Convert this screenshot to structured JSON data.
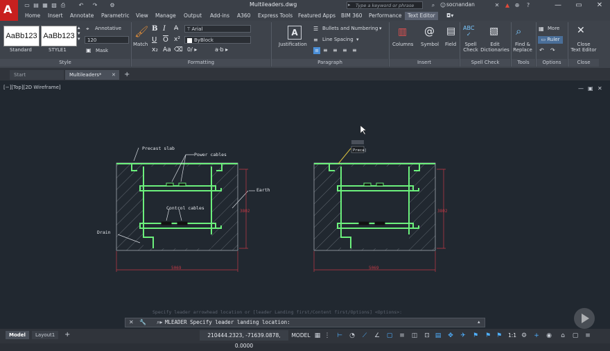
{
  "app": {
    "doc_title": "Multileaders.dwg",
    "search_placeholder": "Type a keyword or phrase",
    "user": "socnandan"
  },
  "ribbon_tabs": [
    "Home",
    "Insert",
    "Annotate",
    "Parametric",
    "View",
    "Manage",
    "Output",
    "Add-ins",
    "A360",
    "Express Tools",
    "Featured Apps",
    "BIM 360",
    "Performance",
    "Text Editor"
  ],
  "ribbon": {
    "style": {
      "style1": "AaBb123",
      "style1_name": "Standard",
      "style2": "AaBb123",
      "style2_name": "STYLE1",
      "annotative": "Annotative",
      "height": "120",
      "mask": "Mask",
      "title": "Style"
    },
    "formatting": {
      "match": "Match",
      "bold": "B",
      "italic": "I",
      "underline": "U",
      "overline": "O",
      "strike": "ʘ",
      "font": "Arial",
      "color": "ByBlock",
      "title": "Formatting"
    },
    "paragraph": {
      "justification": "Justification",
      "bullets": "Bullets and Numbering",
      "line_spacing": "Line Spacing",
      "title": "Paragraph"
    },
    "insert": {
      "columns": "Columns",
      "symbol": "Symbol",
      "field": "Field",
      "title": "Insert"
    },
    "spell": {
      "spell_check_l1": "Spell",
      "spell_check_l2": "Check",
      "edit_dict_l1": "Edit",
      "edit_dict_l2": "Dictionaries",
      "title": "Spell Check"
    },
    "tools": {
      "find_l1": "Find &",
      "find_l2": "Replace",
      "title": "Tools"
    },
    "options": {
      "more": "More",
      "ruler": "Ruler",
      "title": "Options"
    },
    "close": {
      "close_l1": "Close",
      "close_l2": "Text Editor",
      "title": "Close"
    }
  },
  "doc_tabs": {
    "start": "Start",
    "active": "Multileaders*"
  },
  "viewport": {
    "label": "[−][Top][2D Wireframe]"
  },
  "drawing": {
    "labels": {
      "precast": "Precast slab",
      "power": "Power cables",
      "earth": "Earth",
      "control": "Control cables",
      "drain": "Drain",
      "dim_h_left": "5069",
      "dim_v_left": "3802",
      "dim_h_right": "5069",
      "dim_v_right": "3802",
      "typed": "Preca|"
    }
  },
  "command": {
    "history": "Specify leader arrowhead location or [leader Landing first/Content first/Options] <Options>:",
    "prompt": "MLEADER Specify leader landing location:"
  },
  "status": {
    "model_tab": "Model",
    "layout_tab": "Layout1",
    "coords": "210444.2323, -71639.0878, 0.0000",
    "model": "MODEL",
    "scale": "1:1"
  }
}
